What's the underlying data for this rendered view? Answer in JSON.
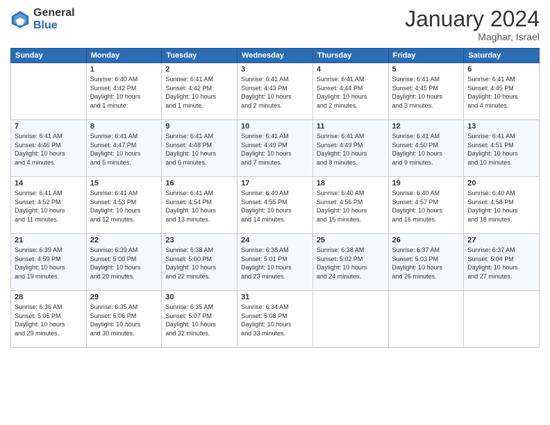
{
  "header": {
    "logo_general": "General",
    "logo_blue": "Blue",
    "month_title": "January 2024",
    "location": "Maghar, Israel"
  },
  "weekdays": [
    "Sunday",
    "Monday",
    "Tuesday",
    "Wednesday",
    "Thursday",
    "Friday",
    "Saturday"
  ],
  "weeks": [
    [
      {
        "day": "",
        "info": ""
      },
      {
        "day": "1",
        "info": "Sunrise: 6:40 AM\nSunset: 4:42 PM\nDaylight: 10 hours\nand 1 minute."
      },
      {
        "day": "2",
        "info": "Sunrise: 6:41 AM\nSunset: 4:42 PM\nDaylight: 10 hours\nand 1 minute."
      },
      {
        "day": "3",
        "info": "Sunrise: 6:41 AM\nSunset: 4:43 PM\nDaylight: 10 hours\nand 2 minutes."
      },
      {
        "day": "4",
        "info": "Sunrise: 6:41 AM\nSunset: 4:44 PM\nDaylight: 10 hours\nand 2 minutes."
      },
      {
        "day": "5",
        "info": "Sunrise: 6:41 AM\nSunset: 4:45 PM\nDaylight: 10 hours\nand 3 minutes."
      },
      {
        "day": "6",
        "info": "Sunrise: 6:41 AM\nSunset: 4:45 PM\nDaylight: 10 hours\nand 4 minutes."
      }
    ],
    [
      {
        "day": "7",
        "info": "Sunrise: 6:41 AM\nSunset: 4:46 PM\nDaylight: 10 hours\nand 4 minutes."
      },
      {
        "day": "8",
        "info": "Sunrise: 6:41 AM\nSunset: 4:47 PM\nDaylight: 10 hours\nand 5 minutes."
      },
      {
        "day": "9",
        "info": "Sunrise: 6:41 AM\nSunset: 4:48 PM\nDaylight: 10 hours\nand 6 minutes."
      },
      {
        "day": "10",
        "info": "Sunrise: 6:41 AM\nSunset: 4:49 PM\nDaylight: 10 hours\nand 7 minutes."
      },
      {
        "day": "11",
        "info": "Sunrise: 6:41 AM\nSunset: 4:49 PM\nDaylight: 10 hours\nand 8 minutes."
      },
      {
        "day": "12",
        "info": "Sunrise: 6:41 AM\nSunset: 4:50 PM\nDaylight: 10 hours\nand 9 minutes."
      },
      {
        "day": "13",
        "info": "Sunrise: 6:41 AM\nSunset: 4:51 PM\nDaylight: 10 hours\nand 10 minutes."
      }
    ],
    [
      {
        "day": "14",
        "info": "Sunrise: 6:41 AM\nSunset: 4:52 PM\nDaylight: 10 hours\nand 11 minutes."
      },
      {
        "day": "15",
        "info": "Sunrise: 6:41 AM\nSunset: 4:53 PM\nDaylight: 10 hours\nand 12 minutes."
      },
      {
        "day": "16",
        "info": "Sunrise: 6:41 AM\nSunset: 4:54 PM\nDaylight: 10 hours\nand 13 minutes."
      },
      {
        "day": "17",
        "info": "Sunrise: 6:40 AM\nSunset: 4:55 PM\nDaylight: 10 hours\nand 14 minutes."
      },
      {
        "day": "18",
        "info": "Sunrise: 6:40 AM\nSunset: 4:56 PM\nDaylight: 10 hours\nand 15 minutes."
      },
      {
        "day": "19",
        "info": "Sunrise: 6:40 AM\nSunset: 4:57 PM\nDaylight: 10 hours\nand 16 minutes."
      },
      {
        "day": "20",
        "info": "Sunrise: 6:40 AM\nSunset: 4:58 PM\nDaylight: 10 hours\nand 18 minutes."
      }
    ],
    [
      {
        "day": "21",
        "info": "Sunrise: 6:39 AM\nSunset: 4:59 PM\nDaylight: 10 hours\nand 19 minutes."
      },
      {
        "day": "22",
        "info": "Sunrise: 6:39 AM\nSunset: 5:00 PM\nDaylight: 10 hours\nand 20 minutes."
      },
      {
        "day": "23",
        "info": "Sunrise: 6:38 AM\nSunset: 5:00 PM\nDaylight: 10 hours\nand 22 minutes."
      },
      {
        "day": "24",
        "info": "Sunrise: 6:38 AM\nSunset: 5:01 PM\nDaylight: 10 hours\nand 23 minutes."
      },
      {
        "day": "25",
        "info": "Sunrise: 6:38 AM\nSunset: 5:02 PM\nDaylight: 10 hours\nand 24 minutes."
      },
      {
        "day": "26",
        "info": "Sunrise: 6:37 AM\nSunset: 5:03 PM\nDaylight: 10 hours\nand 26 minutes."
      },
      {
        "day": "27",
        "info": "Sunrise: 6:37 AM\nSunset: 5:04 PM\nDaylight: 10 hours\nand 27 minutes."
      }
    ],
    [
      {
        "day": "28",
        "info": "Sunrise: 6:36 AM\nSunset: 5:05 PM\nDaylight: 10 hours\nand 29 minutes."
      },
      {
        "day": "29",
        "info": "Sunrise: 6:35 AM\nSunset: 5:06 PM\nDaylight: 10 hours\nand 30 minutes."
      },
      {
        "day": "30",
        "info": "Sunrise: 6:35 AM\nSunset: 5:07 PM\nDaylight: 10 hours\nand 32 minutes."
      },
      {
        "day": "31",
        "info": "Sunrise: 6:34 AM\nSunset: 5:08 PM\nDaylight: 10 hours\nand 33 minutes."
      },
      {
        "day": "",
        "info": ""
      },
      {
        "day": "",
        "info": ""
      },
      {
        "day": "",
        "info": ""
      }
    ]
  ]
}
